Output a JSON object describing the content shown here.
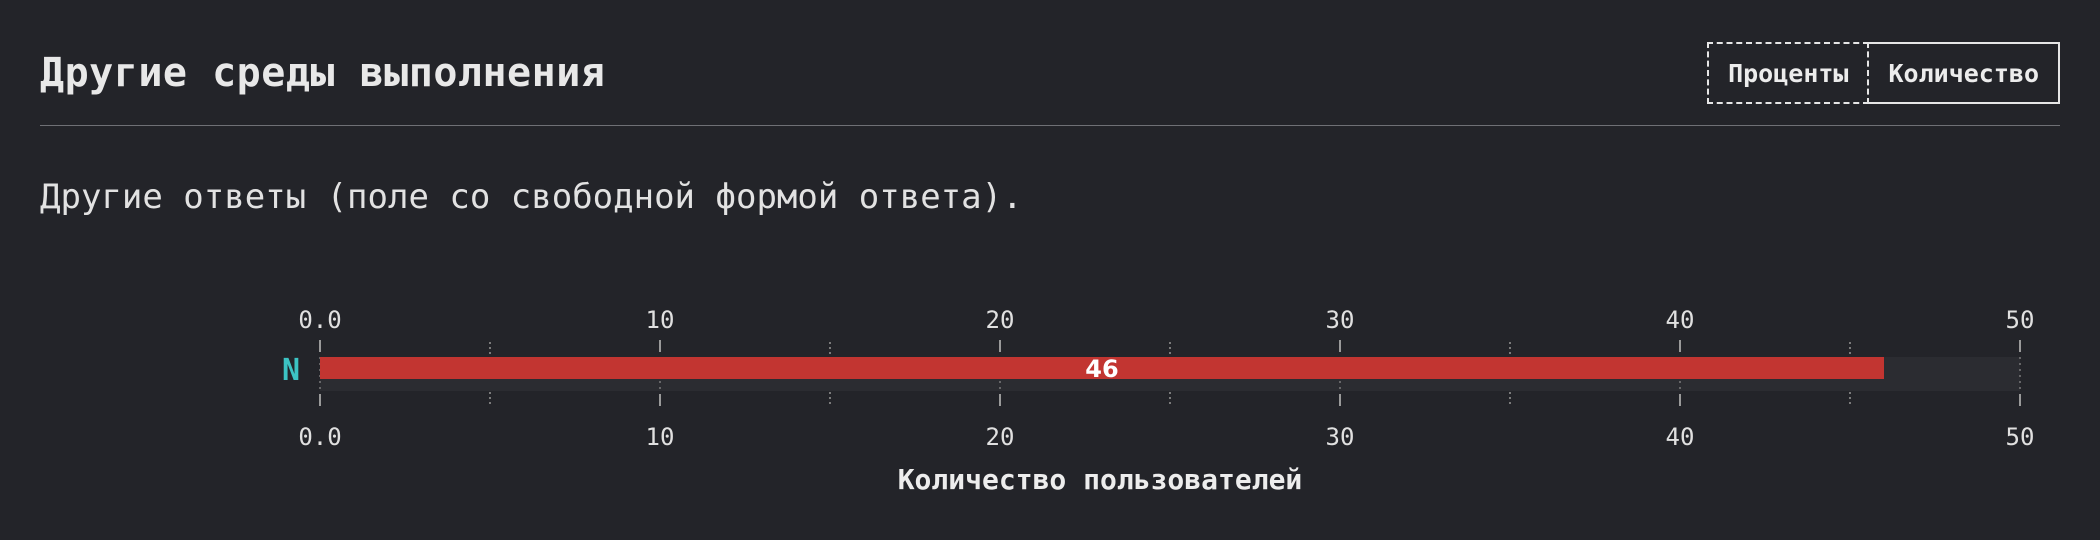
{
  "header": {
    "title": "Другие среды выполнения",
    "toggle": {
      "percent_label": "Проценты",
      "count_label": "Количество",
      "selected": "Количество"
    }
  },
  "description": "Другие ответы (поле со свободной формой ответа).",
  "colors": {
    "background": "#232429",
    "bar": "#c23531",
    "track": "#2b2c31",
    "category_label": "#3cc3c3",
    "tick_major": "#9a9a9a",
    "tick_minor": "#7a7a7a"
  },
  "chart_data": {
    "type": "bar",
    "orientation": "horizontal",
    "categories": [
      "N"
    ],
    "values": [
      46
    ],
    "data_labels": [
      "46"
    ],
    "xlim": [
      0,
      50
    ],
    "tick_values": [
      0,
      10,
      20,
      30,
      40,
      50
    ],
    "tick_labels": [
      "0.0",
      "10",
      "20",
      "30",
      "40",
      "50"
    ],
    "minor_tick_values": [
      5,
      15,
      25,
      35,
      45
    ],
    "xlabel": "Количество пользователей",
    "ylabel": "",
    "title": "",
    "axes": [
      "top",
      "bottom"
    ],
    "grid": false,
    "legend": "none"
  }
}
